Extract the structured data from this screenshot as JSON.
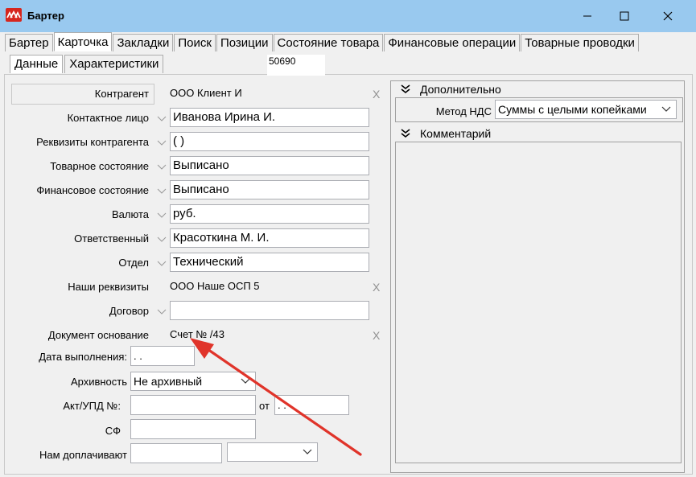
{
  "window": {
    "title": "Бартер",
    "minimize": "—",
    "maximize": "☐",
    "close": "✕"
  },
  "tabs": [
    {
      "label": "Бартер",
      "active": false
    },
    {
      "label": "Карточка",
      "active": true
    },
    {
      "label": "Закладки",
      "active": false
    },
    {
      "label": "Поиск",
      "active": false
    },
    {
      "label": "Позиции",
      "active": false
    },
    {
      "label": "Состояние товара",
      "active": false
    },
    {
      "label": "Финансовые операции",
      "active": false
    },
    {
      "label": "Товарные проводки",
      "active": false
    }
  ],
  "subtabs": [
    {
      "label": "Данные",
      "active": true
    },
    {
      "label": "Характеристики",
      "active": false
    }
  ],
  "doc_number": "50690",
  "form": {
    "kontragent": {
      "label": "Контрагент",
      "value": "ООО Клиент И",
      "clear": "X"
    },
    "contact": {
      "label": "Контактное лицо",
      "value": "Иванова Ирина И."
    },
    "rekvizity": {
      "label": "Реквизиты контрагента",
      "value": "  (   )"
    },
    "tovar_state": {
      "label": "Товарное состояние",
      "value": "Выписано"
    },
    "fin_state": {
      "label": "Финансовое состояние",
      "value": "Выписано"
    },
    "currency": {
      "label": "Валюта",
      "value": "руб."
    },
    "responsible": {
      "label": "Ответственный",
      "value": "Красоткина М. И."
    },
    "department": {
      "label": "Отдел",
      "value": "Технический"
    },
    "our_rekv": {
      "label": "Наши реквизиты",
      "value": "ООО Наше ОСП 5",
      "clear": "X"
    },
    "contract": {
      "label": "Договор",
      "value": ""
    },
    "base_doc": {
      "label": "Документ основание",
      "value": "Счет №  /43",
      "clear": "X"
    },
    "due_date": {
      "label": "Дата выполнения:",
      "value": " .  ."
    },
    "archive": {
      "label": "Архивность",
      "value": "Не архивный"
    },
    "act": {
      "label": "Акт/УПД №:",
      "value": "",
      "from_label": "от",
      "date": " .  ."
    },
    "sf": {
      "label": "СФ",
      "value": ""
    },
    "surcharge": {
      "label": "Нам доплачивают",
      "value": "",
      "currency_value": ""
    }
  },
  "right": {
    "additional": {
      "title": "Дополнительно"
    },
    "vat": {
      "label": "Метод НДС",
      "value": "Суммы с целыми копейками"
    },
    "comment": {
      "title": "Комментарий"
    }
  },
  "colors": {
    "titlebar": "#99c9ef",
    "arrow": "#e0342a",
    "app_icon": "#d6261e"
  }
}
